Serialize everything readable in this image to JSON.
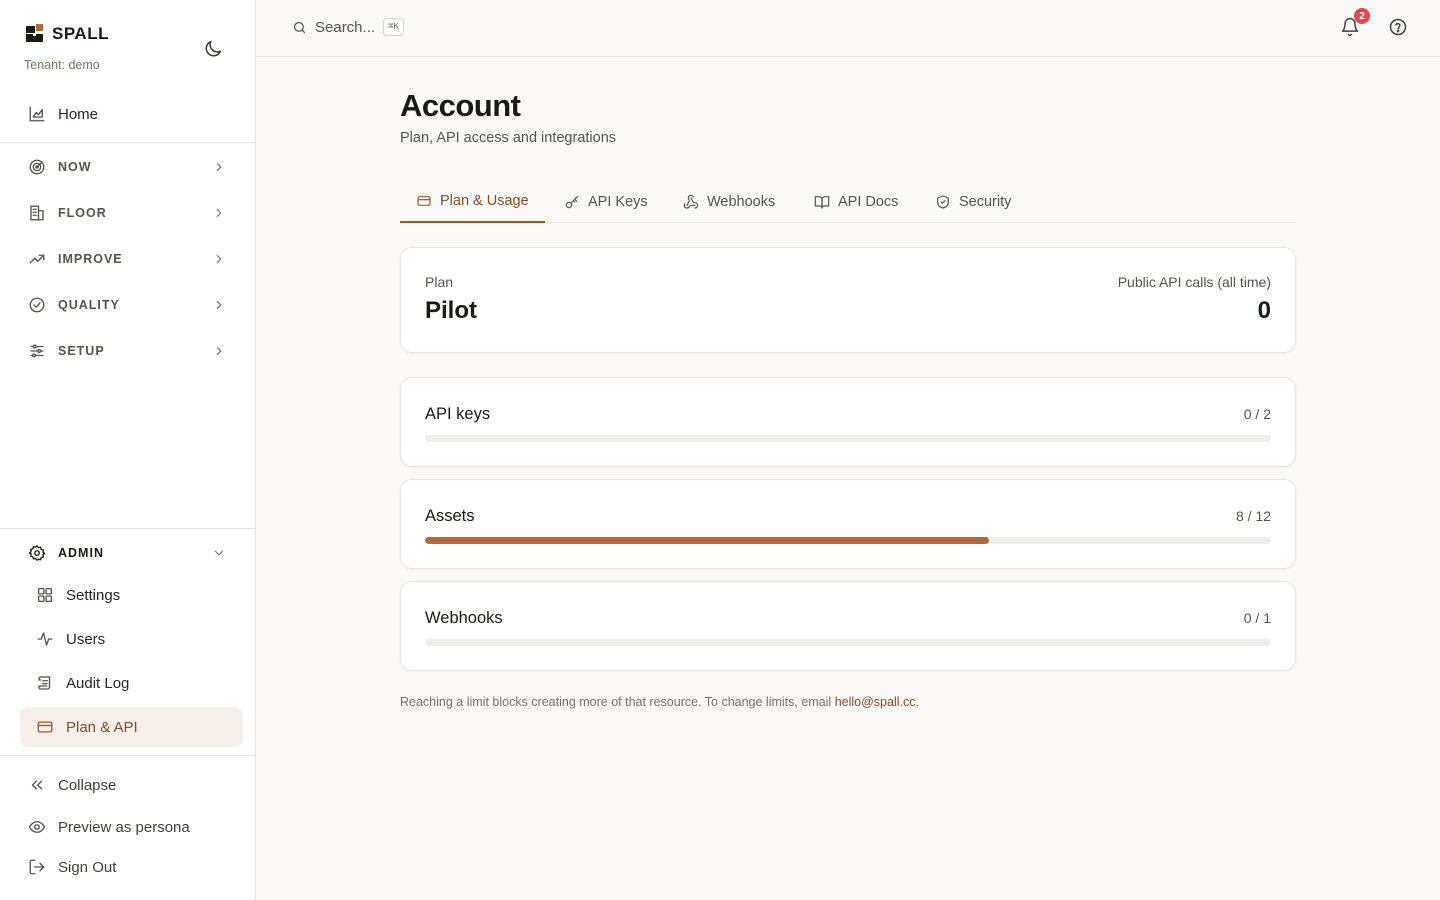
{
  "brand": {
    "name": "SPALL",
    "tenant": "Tenant: demo"
  },
  "sidebar": {
    "home": "Home",
    "groups": [
      "NOW",
      "FLOOR",
      "IMPROVE",
      "QUALITY",
      "SETUP"
    ],
    "admin": {
      "label": "ADMIN",
      "items": [
        "Settings",
        "Users",
        "Audit Log",
        "Plan & API"
      ]
    },
    "bottom": [
      "Collapse",
      "Preview as persona",
      "Sign Out"
    ]
  },
  "topbar": {
    "search_label": "Search...",
    "shortcut": "⌘K",
    "notifications": "2"
  },
  "page": {
    "title": "Account",
    "subtitle": "Plan, API access and integrations",
    "tabs": [
      "Plan & Usage",
      "API Keys",
      "Webhooks",
      "API Docs",
      "Security"
    ]
  },
  "plan": {
    "label": "Plan",
    "value": "Pilot",
    "calls_label": "Public API calls (all time)",
    "calls_value": "0"
  },
  "usage": [
    {
      "name": "API keys",
      "count": "0 / 2",
      "fraction": 0
    },
    {
      "name": "Assets",
      "count": "8 / 12",
      "fraction": 0.6667
    },
    {
      "name": "Webhooks",
      "count": "0 / 1",
      "fraction": 0
    }
  ],
  "footnote": {
    "text": "Reaching a limit blocks creating more of that resource. To change limits, email ",
    "email": "hello@spall.cc",
    "end": "."
  },
  "colors": {
    "accent": "#a0592b",
    "bar_fill": "#b06a3b",
    "active_bg": "#f7efe9",
    "badge": "#e5484d"
  }
}
